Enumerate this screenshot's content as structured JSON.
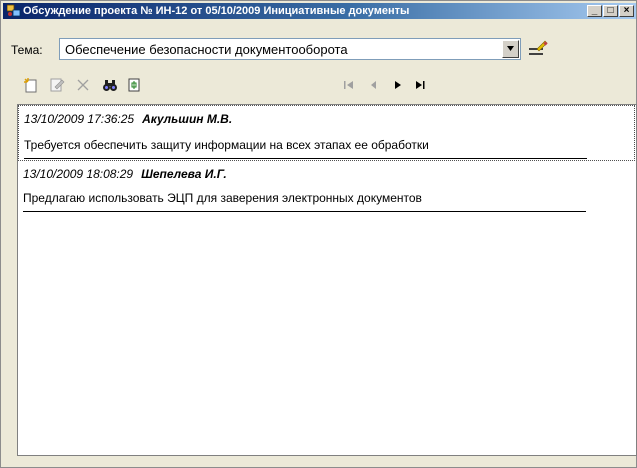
{
  "window": {
    "title": "Обсуждение проекта № ИН-12 от 05/10/2009 Инициативные документы",
    "minimize_label": "_",
    "maximize_label": "□",
    "close_label": "×"
  },
  "topic": {
    "label": "Тема:",
    "value": "Обеспечение безопасности документооборота"
  },
  "toolbar": {
    "icons": [
      "new-post-icon",
      "edit-post-icon",
      "delete-post-icon",
      "find-icon",
      "export-icon"
    ],
    "nav_icons": [
      "first-record-icon",
      "previous-record-icon",
      "next-record-icon",
      "last-record-icon"
    ]
  },
  "posts": [
    {
      "date": "13/10/2009 17:36:25",
      "author": "Акульшин М.В.",
      "text": "Требуется обеспечить защиту информации на всех этапах ее обработки"
    },
    {
      "date": "13/10/2009 18:08:29",
      "author": "Шепелева И.Г.",
      "text": "Предлагаю использовать ЭЦП для заверения электронных документов"
    }
  ],
  "colors": {
    "titlebar_start": "#0a246a",
    "titlebar_end": "#a6caf0",
    "window_bg": "#ece9d8"
  }
}
